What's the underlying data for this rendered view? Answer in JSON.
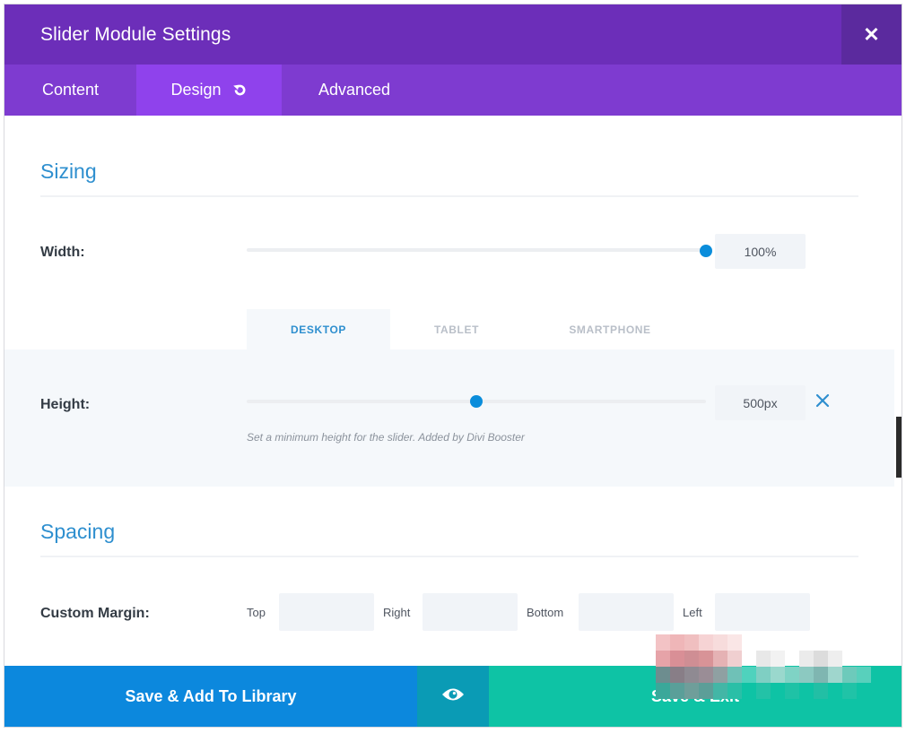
{
  "header": {
    "title": "Slider Module Settings",
    "close_symbol": "✕"
  },
  "tabs": [
    {
      "label": "Content",
      "active": false
    },
    {
      "label": "Design",
      "active": true,
      "icon": "reset-icon"
    },
    {
      "label": "Advanced",
      "active": false
    }
  ],
  "sizing": {
    "title": "Sizing",
    "width": {
      "label": "Width:",
      "value": "100%",
      "level": 1.0
    },
    "device_tabs": [
      "DESKTOP",
      "TABLET",
      "SMARTPHONE"
    ],
    "active_device": "DESKTOP",
    "height": {
      "label": "Height:",
      "value": "500px",
      "level": 0.5,
      "help": "Set a minimum height for the slider. Added by Divi Booster"
    }
  },
  "spacing": {
    "title": "Spacing",
    "margin": {
      "label": "Custom Margin:",
      "fields": [
        {
          "label": "Top",
          "value": ""
        },
        {
          "label": "Right",
          "value": ""
        },
        {
          "label": "Bottom",
          "value": ""
        },
        {
          "label": "Left",
          "value": ""
        }
      ]
    }
  },
  "footer": {
    "save_library_label": "Save & Add To Library",
    "preview_icon": "eye-icon",
    "save_exit_label": "Save & Exit"
  },
  "colors": {
    "header": "#6c2eb9",
    "tabs": "#7e3bd0",
    "active_tab": "#8f42ec",
    "accent_blue": "#0a8ddb",
    "save_library": "#0c88dd",
    "preview": "#0a9bb5",
    "save_exit": "#0ec3a5"
  }
}
